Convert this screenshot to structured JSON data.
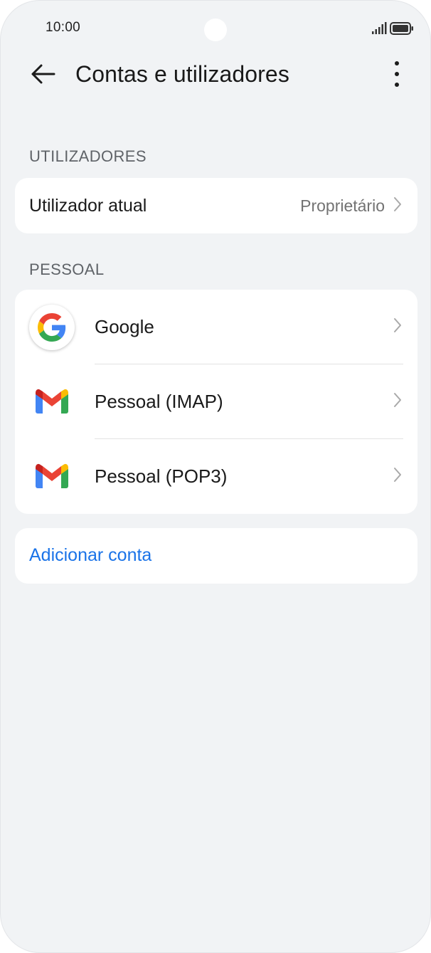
{
  "status_bar": {
    "time": "10:00",
    "signal_icon": "signal-bars-icon",
    "battery_icon": "battery-full-icon"
  },
  "app_bar": {
    "title": "Contas e utilizadores",
    "back_icon": "arrow-left-icon",
    "more_icon": "more-vertical-icon"
  },
  "users_section": {
    "header": "UTILIZADORES",
    "current_user": {
      "label": "Utilizador atual",
      "value": "Proprietário"
    }
  },
  "personal_section": {
    "header": "PESSOAL",
    "accounts": [
      {
        "label": "Google",
        "icon": "google-icon"
      },
      {
        "label": "Pessoal (IMAP)",
        "icon": "gmail-icon"
      },
      {
        "label": "Pessoal (POP3)",
        "icon": "gmail-icon"
      }
    ]
  },
  "add_account": {
    "label": "Adicionar conta"
  },
  "colors": {
    "background": "#f1f3f5",
    "card": "#ffffff",
    "accent": "#1a73e8"
  }
}
